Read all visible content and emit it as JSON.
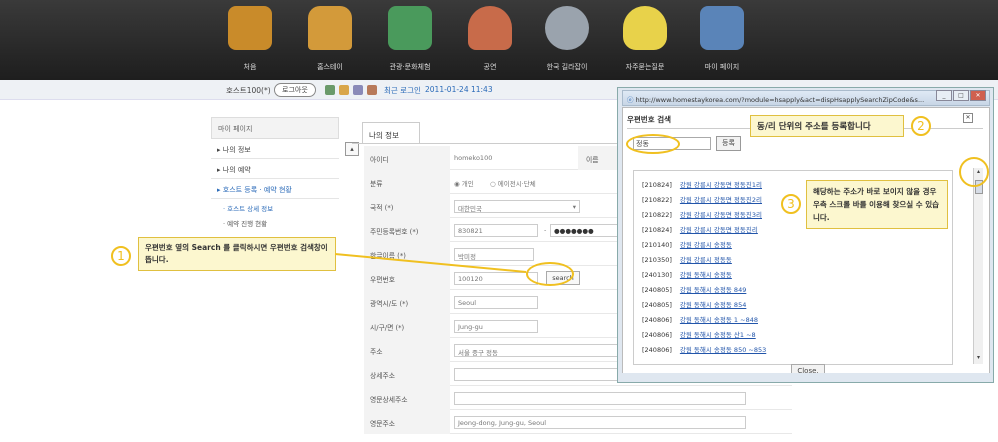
{
  "nav": [
    {
      "label": "처음",
      "icon": "house-icon",
      "color": "#c98b2a"
    },
    {
      "label": "홈스테이",
      "icon": "sofa-icon",
      "color": "#d39a3a"
    },
    {
      "label": "관광·문화체험",
      "icon": "map-icon",
      "color": "#4a9a5c"
    },
    {
      "label": "공연",
      "icon": "drums-icon",
      "color": "#c86b4a"
    },
    {
      "label": "한국 길라잡이",
      "icon": "compass-icon",
      "color": "#9aa3ad"
    },
    {
      "label": "자주묻는질문",
      "icon": "lightbulb-icon",
      "color": "#e8d24a"
    },
    {
      "label": "마이 페이지",
      "icon": "id-card-icon",
      "color": "#5a84b8"
    }
  ],
  "toolbar": {
    "user": "호스트100(*)",
    "logout": "로그아웃",
    "last_login_label": "최근 로그인",
    "last_login_value": "2011-01-24 11:43"
  },
  "sidebar": {
    "title": "마이 페이지",
    "items": [
      "나의 정보",
      "나의 예약",
      "호스트 등록 · 예약 현황"
    ],
    "subitems": [
      "· 호스트 상세 정보",
      "· 예약 진행 현황"
    ]
  },
  "main": {
    "tab": "나의 정보",
    "fields": {
      "id_label": "아이디",
      "id_value": "homeko100",
      "name_label": "이름",
      "type_label": "분류",
      "type_opt1": "개인",
      "type_opt2": "에이전시·단체",
      "country_label": "국적 (*)",
      "country_value": "대한민국",
      "rrn_label": "주민등록번호 (*)",
      "rrn_front": "830821",
      "rrn_back": "●●●●●●●",
      "korean_name_label": "한글이름 (*)",
      "korean_name_value": "박미정",
      "zip_label": "우편번호",
      "zip_value": "100120",
      "search_btn": "search",
      "city_label": "광역시/도 (*)",
      "city_value": "Seoul",
      "district_label": "시/구/면 (*)",
      "district_value": "Jung-gu",
      "address_label": "주소",
      "address_value": "서울 중구 정동",
      "detail_label": "상세주소",
      "eng_detail_label": "영문상세주소",
      "eng_address_label": "영문주소",
      "eng_address_value": "Jeong-dong, Jung-gu, Seoul"
    }
  },
  "callouts": {
    "c1_num": "1",
    "c1_text": "우편번호 옆의 Search 를 클릭하시면 우편번호 검색창이 뜹니다.",
    "c2_num": "2",
    "c2_text": "동/리  단위의 주소를 등록합니다",
    "c3_num": "3",
    "c3_text": "해당하는 주소가 바로 보이지 않을 경우 우측 스크롤 바를 이용해 찾으실 수 있습니다."
  },
  "popup": {
    "url": "http://www.homestaykorea.com/?module=hsapply&act=dispHsapplySearchZipCode&s...",
    "title": "우편번호 검색",
    "query": "정동",
    "register_btn": "등록",
    "close_btn": "Close.",
    "results": [
      {
        "zip": "[210824]",
        "addr": "강원 강릉시 강동면 정동진1리"
      },
      {
        "zip": "[210822]",
        "addr": "강원 강릉시 강동면 정동진2리"
      },
      {
        "zip": "[210822]",
        "addr": "강원 강릉시 강동면 정동진3리"
      },
      {
        "zip": "[210824]",
        "addr": "강원 강릉시 강동면 정동진리"
      },
      {
        "zip": "[210140]",
        "addr": "강원 강릉시 송정동"
      },
      {
        "zip": "[210350]",
        "addr": "강원 강릉시 정동동"
      },
      {
        "zip": "[240130]",
        "addr": "강원 동해시 송정동"
      },
      {
        "zip": "[240805]",
        "addr": "강원 동해시 송정동 849"
      },
      {
        "zip": "[240805]",
        "addr": "강원 동해시 송정동 854"
      },
      {
        "zip": "[240806]",
        "addr": "강원 동해시 송정동 1 ~848"
      },
      {
        "zip": "[240806]",
        "addr": "강원 동해시 송정동 산1 ~8"
      },
      {
        "zip": "[240806]",
        "addr": "강원 동해시 송정동 850 ~853"
      }
    ]
  }
}
